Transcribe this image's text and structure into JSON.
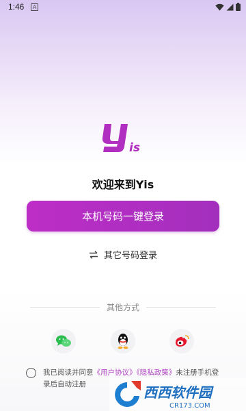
{
  "status_bar": {
    "time": "1:46",
    "notification_glyph": "A"
  },
  "logo": {
    "text": "Yis",
    "color": "#b12fc0"
  },
  "welcome": {
    "title": "欢迎来到Yis"
  },
  "primary_button": {
    "label": "本机号码一键登录",
    "color": "#b52ec3"
  },
  "other_login": {
    "label": "其它号码登录",
    "icon": "swap-icon"
  },
  "alt_methods": {
    "label": "其他方式",
    "items": [
      {
        "name": "wechat",
        "icon": "wechat-icon"
      },
      {
        "name": "qq",
        "icon": "qq-icon"
      },
      {
        "name": "weibo",
        "icon": "weibo-icon"
      }
    ]
  },
  "agreement": {
    "prefix": "我已阅读并同意",
    "user_agreement": "《用户协议》",
    "privacy_policy": "《隐私政策》",
    "suffix": "未注册手机登录后自动注册",
    "checked": false
  },
  "watermark": {
    "brand": "西西软件园",
    "url": "CR173.COM"
  }
}
